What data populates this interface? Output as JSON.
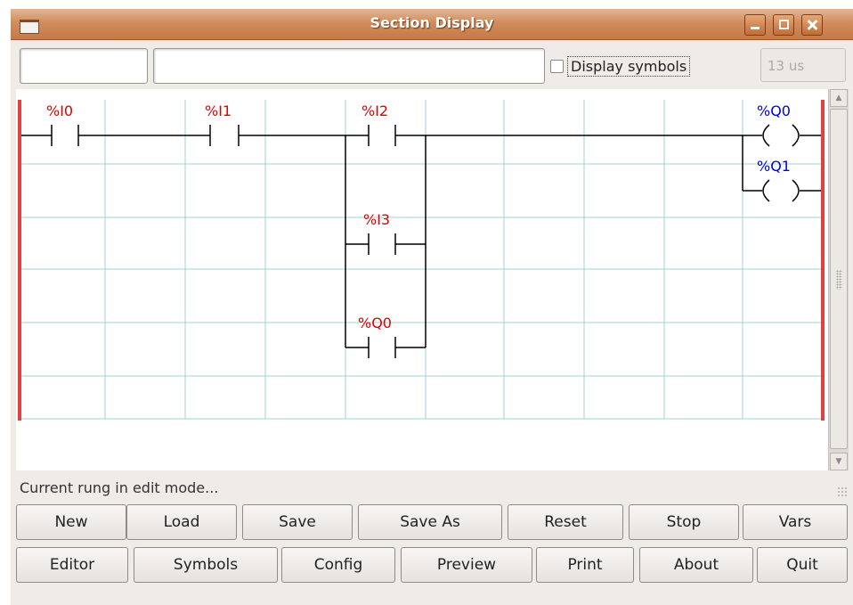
{
  "caption_fragment": "... ... ... ...",
  "window": {
    "title": "Section Display",
    "minimize_label": "minimize",
    "maximize_label": "maximize",
    "close_label": "close"
  },
  "toolbar": {
    "field1_value": "",
    "field2_value": "",
    "display_symbols_label": "Display symbols",
    "display_symbols_checked": false,
    "cycle_time": "13 us"
  },
  "ladder": {
    "contacts": [
      {
        "label": "%I0"
      },
      {
        "label": "%I1"
      },
      {
        "label": "%I2"
      },
      {
        "label": "%I3"
      },
      {
        "label": "%Q0"
      }
    ],
    "coils": [
      {
        "label": "%Q0"
      },
      {
        "label": "%Q1"
      }
    ],
    "colors": {
      "rail": "#e04040",
      "grid": "#9fd3d6",
      "input_label": "#e00000",
      "output_label": "#0000e0",
      "wire": "#000000"
    }
  },
  "statusbar": {
    "text": "Current rung in edit mode..."
  },
  "buttons": {
    "row1": [
      "New",
      "Load",
      "Save",
      "Save As",
      "Reset",
      "Stop",
      "Vars"
    ],
    "row2": [
      "Editor",
      "Symbols",
      "Config",
      "Preview",
      "Print",
      "About",
      "Quit"
    ]
  }
}
